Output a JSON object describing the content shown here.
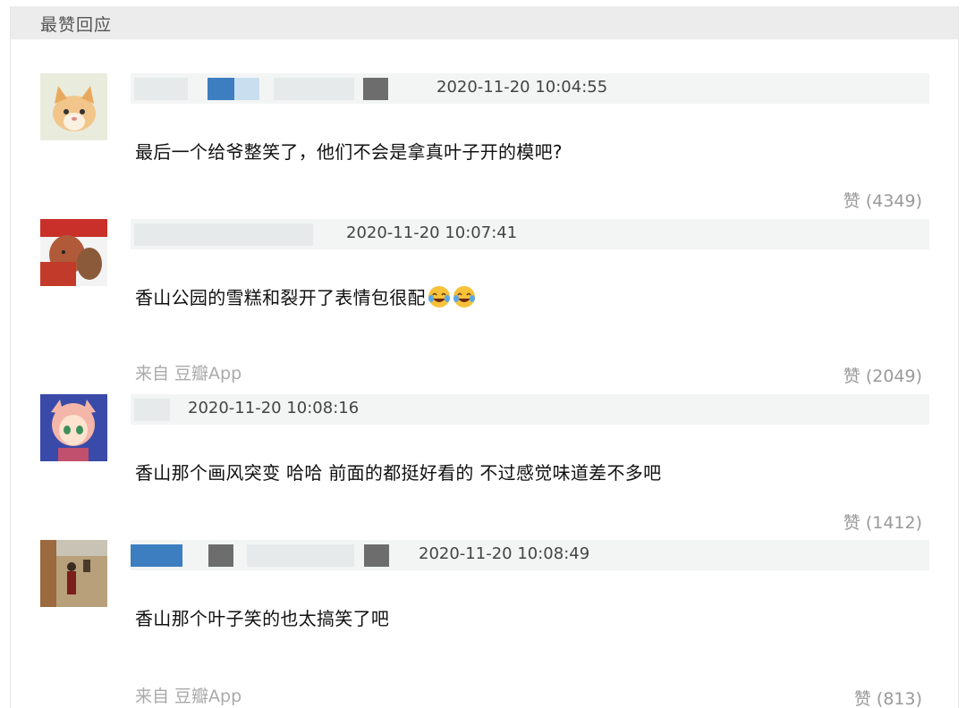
{
  "section": {
    "title": "最赞回应"
  },
  "comments": [
    {
      "timestamp": "2020-11-20 10:04:55",
      "text": "最后一个给爷整笑了，他们不会是拿真叶子开的模吧?",
      "source": "",
      "like_label": "赞",
      "like_count": "(4349)",
      "avatar": "cat-avatar"
    },
    {
      "timestamp": "2020-11-20 10:07:41",
      "text": "香山公园的雪糕和裂开了表情包很配",
      "emoji": [
        "tears-of-joy",
        "tears-of-joy"
      ],
      "source": "来自 豆瓣App",
      "like_label": "赞",
      "like_count": "(2049)",
      "avatar": "monk-avatar"
    },
    {
      "timestamp": "2020-11-20 10:08:16",
      "text": "香山那个画风突变 哈哈 前面的都挺好看的 不过感觉味道差不多吧",
      "source": "",
      "like_label": "赞",
      "like_count": "(1412)",
      "avatar": "anime-girl-avatar"
    },
    {
      "timestamp": "2020-11-20 10:08:49",
      "text": "香山那个叶子笑的也太搞笑了吧",
      "source": "来自 豆瓣App",
      "like_label": "赞",
      "like_count": "(813)",
      "avatar": "field-photo-avatar"
    }
  ]
}
